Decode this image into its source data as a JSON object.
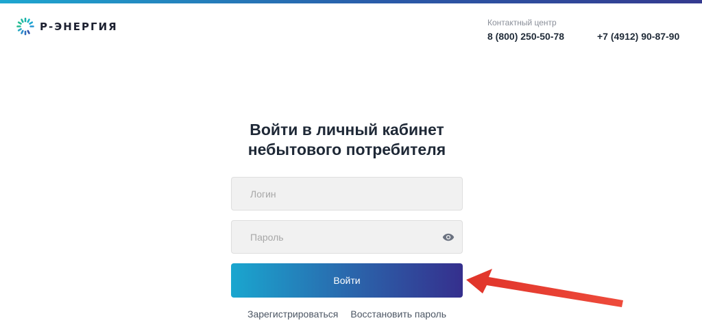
{
  "brand": {
    "name": "Р-ЭНЕРГИЯ",
    "logo_icon": "spiral-logo-icon",
    "colors": {
      "cyan": "#1ea7d0",
      "blue": "#2a5aa8",
      "indigo": "#343a8f"
    }
  },
  "header": {
    "contact_label": "Контактный центр",
    "phone_primary": "8 (800) 250-50-78",
    "phone_secondary": "+7 (4912) 90-87-90"
  },
  "login_form": {
    "title_line1": "Войти в личный кабинет",
    "title_line2": "небытового потребителя",
    "login_placeholder": "Логин",
    "login_value": "",
    "password_placeholder": "Пароль",
    "password_value": "",
    "password_toggle_icon": "eye-icon",
    "submit_label": "Войти",
    "register_link": "Зарегистрироваться",
    "restore_link": "Восстановить пароль"
  },
  "annotation": {
    "icon": "red-arrow-icon",
    "color": "#e53a2f"
  }
}
